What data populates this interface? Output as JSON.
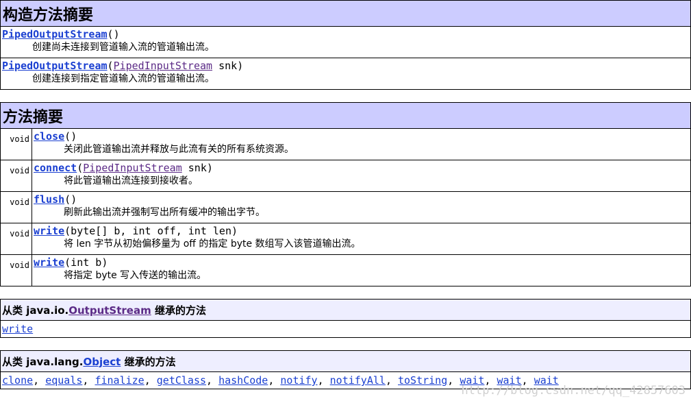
{
  "constructors": {
    "heading": "构造方法摘要",
    "items": [
      {
        "name": "PipedOutputStream",
        "sig_open": "(",
        "param_type": "",
        "param_rest": "",
        "sig_close": ")",
        "desc": "创建尚未连接到管道输入流的管道输出流。"
      },
      {
        "name": "PipedOutputStream",
        "sig_open": "(",
        "param_type": "PipedInputStream",
        "param_rest": " snk",
        "sig_close": ")",
        "desc": "创建连接到指定管道输入流的管道输出流。"
      }
    ]
  },
  "methods": {
    "heading": "方法摘要",
    "items": [
      {
        "type": "void",
        "name": "close",
        "sig_open": "(",
        "param_type": "",
        "param_rest": "",
        "sig_close": ")",
        "desc": "关闭此管道输出流并释放与此流有关的所有系统资源。"
      },
      {
        "type": "void",
        "name": "connect",
        "sig_open": "(",
        "param_type": "PipedInputStream",
        "param_rest": " snk",
        "sig_close": ")",
        "desc": "将此管道输出流连接到接收者。"
      },
      {
        "type": "void",
        "name": "flush",
        "sig_open": "(",
        "param_type": "",
        "param_rest": "",
        "sig_close": ")",
        "desc": "刷新此输出流并强制写出所有缓冲的输出字节。"
      },
      {
        "type": "void",
        "name": "write",
        "sig_open": "(byte[] b, int off, int len",
        "param_type": "",
        "param_rest": "",
        "sig_close": ")",
        "desc": "将 len 字节从初始偏移量为 off 的指定 byte 数组写入该管道输出流。"
      },
      {
        "type": "void",
        "name": "write",
        "sig_open": "(int b",
        "param_type": "",
        "param_rest": "",
        "sig_close": ")",
        "desc": "将指定 byte 写入传送的输出流。"
      }
    ]
  },
  "inherited_output": {
    "prefix": "从类 java.io.",
    "class_link": "OutputStream",
    "suffix": " 继承的方法",
    "methods": [
      "write"
    ]
  },
  "inherited_object": {
    "prefix": "从类 java.lang.",
    "class_link": "Object",
    "suffix": " 继承的方法",
    "methods": [
      "clone",
      "equals",
      "finalize",
      "getClass",
      "hashCode",
      "notify",
      "notifyAll",
      "toString",
      "wait",
      "wait",
      "wait"
    ]
  },
  "watermark": "http://blog.csdn.net/qq_42857603"
}
